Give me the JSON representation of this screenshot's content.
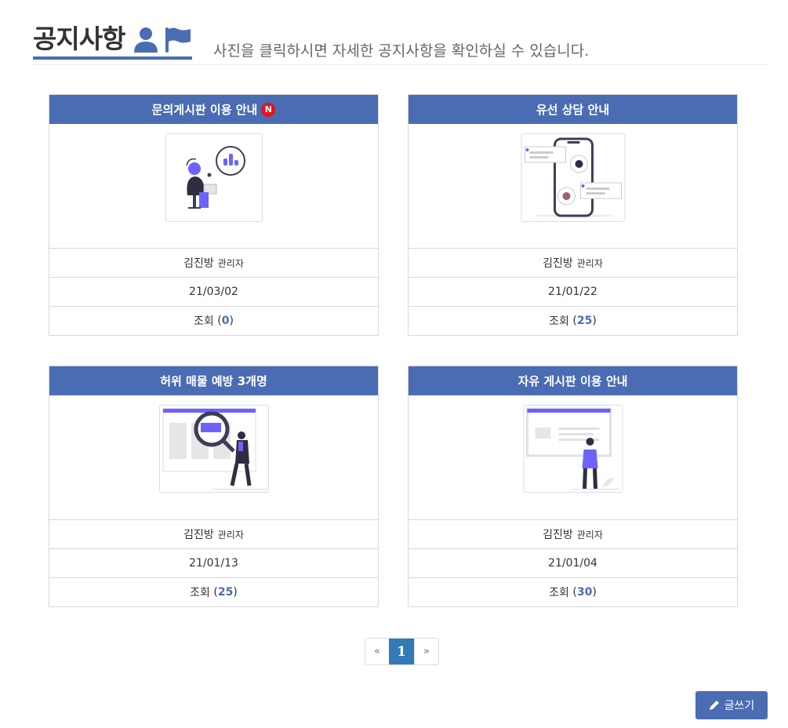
{
  "header": {
    "title": "공지사항",
    "subtitle": "사진을 클릭하시면 자세한 공지사항을 확인하실 수 있습니다.",
    "icons": [
      "user-icon",
      "flag-icon"
    ],
    "accent": "#4a6cb3"
  },
  "cards": [
    {
      "title": "문의게시판 이용 안내",
      "new_badge": "N",
      "author": "김진방",
      "role": "관리자",
      "date": "21/03/02",
      "views_label": "조회",
      "views_open": "(",
      "views": "0",
      "views_close": ")",
      "image": "support-illustration"
    },
    {
      "title": "유선 상담 안내",
      "author": "김진방",
      "role": "관리자",
      "date": "21/01/22",
      "views_label": "조회",
      "views_open": "(",
      "views": "25",
      "views_close": ")",
      "image": "phone-chat-illustration"
    },
    {
      "title": "허위 매물 예방 3개명",
      "author": "김진방",
      "role": "관리자",
      "date": "21/01/13",
      "views_label": "조회",
      "views_open": "(",
      "views": "25",
      "views_close": ")",
      "image": "search-illustration"
    },
    {
      "title": "자유 게시판 이용 안내",
      "author": "김진방",
      "role": "관리자",
      "date": "21/01/04",
      "views_label": "조회",
      "views_open": "(",
      "views": "30",
      "views_close": ")",
      "image": "board-illustration"
    }
  ],
  "pagination": {
    "prev": "«",
    "current": "1",
    "next": "»"
  },
  "write_button": {
    "label": "글쓰기",
    "icon": "pencil-icon"
  }
}
